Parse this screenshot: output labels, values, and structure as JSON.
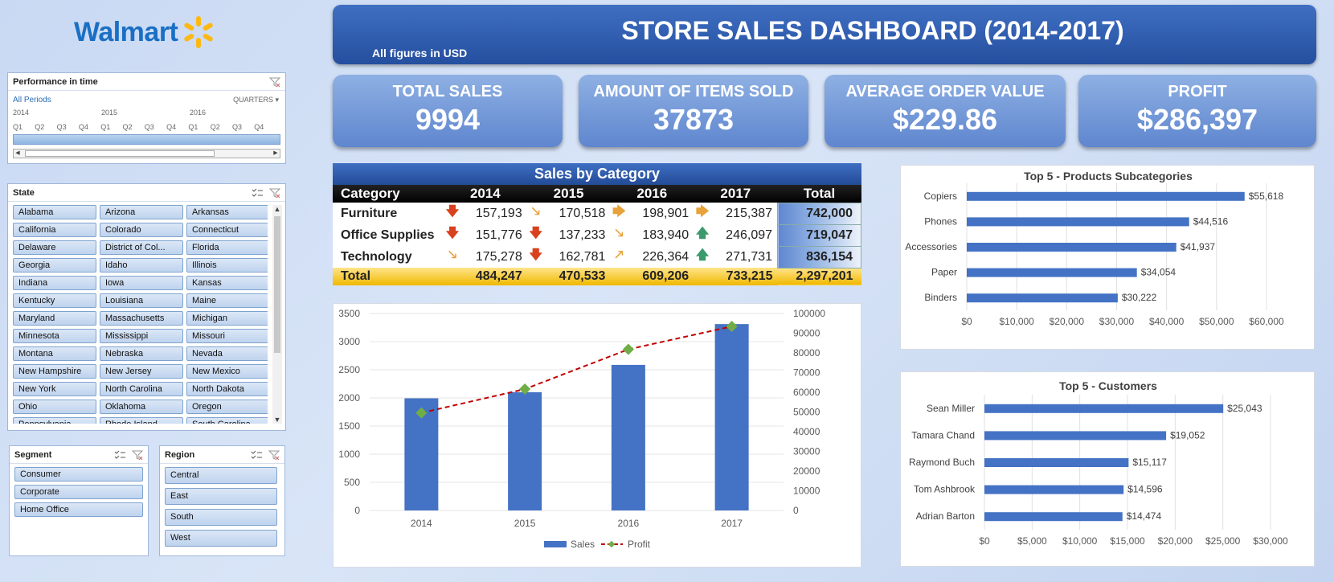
{
  "logo": {
    "text": "Walmart"
  },
  "banner": {
    "title": "STORE SALES DASHBOARD (2014-2017)",
    "subtitle": "All figures in USD"
  },
  "kpis": [
    {
      "label": "TOTAL SALES",
      "value": "9994"
    },
    {
      "label": "AMOUNT OF ITEMS SOLD",
      "value": "37873"
    },
    {
      "label": "AVERAGE ORDER VALUE",
      "value": "$229.86"
    },
    {
      "label": "PROFIT",
      "value": "$286,397"
    }
  ],
  "timeline": {
    "title": "Performance in time",
    "all_periods": "All Periods",
    "level": "QUARTERS",
    "years": [
      "2014",
      "2015",
      "2016"
    ],
    "quarters": [
      "Q1",
      "Q2",
      "Q3",
      "Q4",
      "Q1",
      "Q2",
      "Q3",
      "Q4",
      "Q1",
      "Q2",
      "Q3",
      "Q4"
    ]
  },
  "state": {
    "title": "State",
    "items": [
      "Alabama",
      "Arizona",
      "Arkansas",
      "California",
      "Colorado",
      "Connecticut",
      "Delaware",
      "District of Col...",
      "Florida",
      "Georgia",
      "Idaho",
      "Illinois",
      "Indiana",
      "Iowa",
      "Kansas",
      "Kentucky",
      "Louisiana",
      "Maine",
      "Maryland",
      "Massachusetts",
      "Michigan",
      "Minnesota",
      "Mississippi",
      "Missouri",
      "Montana",
      "Nebraska",
      "Nevada",
      "New Hampshire",
      "New Jersey",
      "New Mexico",
      "New York",
      "North Carolina",
      "North Dakota",
      "Ohio",
      "Oklahoma",
      "Oregon",
      "Pennsylvania",
      "Rhode Island",
      "South Carolina"
    ]
  },
  "segment": {
    "title": "Segment",
    "items": [
      "Consumer",
      "Corporate",
      "Home Office"
    ]
  },
  "region": {
    "title": "Region",
    "items": [
      "Central",
      "East",
      "South",
      "West"
    ]
  },
  "category_table": {
    "title": "Sales by Category",
    "headers": [
      "Category",
      "2014",
      "2015",
      "2016",
      "2017",
      "Total"
    ],
    "rows": [
      {
        "name": "Furniture",
        "values": [
          "157,193",
          "170,518",
          "198,901",
          "215,387"
        ],
        "arrows": [
          "down",
          "diag",
          "side",
          "side"
        ],
        "total": "742,000"
      },
      {
        "name": "Office Supplies",
        "values": [
          "151,776",
          "137,233",
          "183,940",
          "246,097"
        ],
        "arrows": [
          "down",
          "down",
          "diag",
          "up"
        ],
        "total": "719,047"
      },
      {
        "name": "Technology",
        "values": [
          "175,278",
          "162,781",
          "226,364",
          "271,731"
        ],
        "arrows": [
          "diag",
          "down",
          "diag-up",
          "up"
        ],
        "total": "836,154"
      }
    ],
    "total_row": {
      "name": "Total",
      "values": [
        "484,247",
        "470,533",
        "609,206",
        "733,215"
      ],
      "total": "2,297,201"
    }
  },
  "chart_data": [
    {
      "type": "bar",
      "categories": [
        "2014",
        "2015",
        "2016",
        "2017"
      ],
      "series": [
        {
          "name": "Sales",
          "type": "bar",
          "axis": "left",
          "values": [
            1993,
            2102,
            2587,
            3312
          ],
          "color": "#4472c4"
        },
        {
          "name": "Profit",
          "type": "line",
          "axis": "right",
          "values": [
            49544,
            61619,
            81795,
            93439
          ],
          "color": "#c00000",
          "marker_color": "#70ad47"
        }
      ],
      "y_left": {
        "min": 0,
        "max": 3500,
        "ticks": [
          "0",
          "500",
          "1000",
          "1500",
          "2000",
          "2500",
          "3000",
          "3500"
        ]
      },
      "y_right": {
        "min": 0,
        "max": 100000,
        "ticks": [
          "0",
          "10000",
          "20000",
          "30000",
          "40000",
          "50000",
          "60000",
          "70000",
          "80000",
          "90000",
          "100000"
        ]
      },
      "legend": "bottom"
    },
    {
      "type": "bar",
      "orientation": "horizontal",
      "title": "Top 5 - Products Subcategories",
      "categories": [
        "Copiers",
        "Phones",
        "Accessories",
        "Paper",
        "Binders"
      ],
      "values": [
        55618,
        44516,
        41937,
        34054,
        30222
      ],
      "data_labels": [
        "$55,618",
        "$44,516",
        "$41,937",
        "$34,054",
        "$30,222"
      ],
      "xlim": [
        0,
        60000
      ],
      "x_ticks": [
        "$0",
        "$10,000",
        "$20,000",
        "$30,000",
        "$40,000",
        "$50,000",
        "$60,000"
      ],
      "color": "#4472c4"
    },
    {
      "type": "bar",
      "orientation": "horizontal",
      "title": "Top 5 - Customers",
      "categories": [
        "Sean Miller",
        "Tamara Chand",
        "Raymond Buch",
        "Tom Ashbrook",
        "Adrian Barton"
      ],
      "values": [
        25043,
        19052,
        15117,
        14596,
        14474
      ],
      "data_labels": [
        "$25,043",
        "$19,052",
        "$15,117",
        "$14,596",
        "$14,474"
      ],
      "xlim": [
        0,
        30000
      ],
      "x_ticks": [
        "$0",
        "$5,000",
        "$10,000",
        "$15,000",
        "$20,000",
        "$25,000",
        "$30,000"
      ],
      "color": "#4472c4"
    }
  ]
}
